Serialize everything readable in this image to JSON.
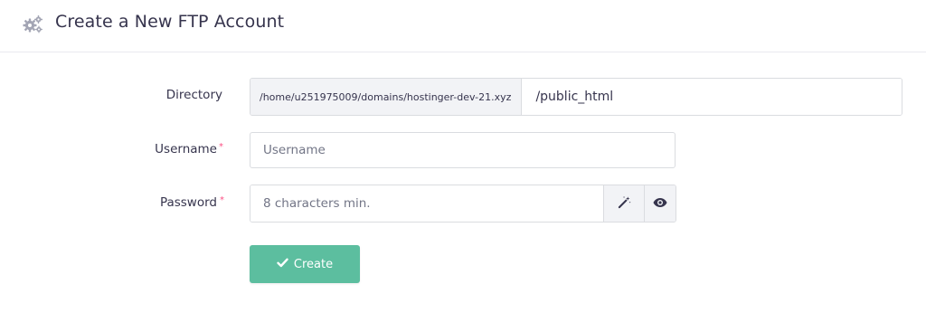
{
  "header": {
    "icon": "cogs-icon",
    "title": "Create a New FTP Account"
  },
  "form": {
    "directory": {
      "label": "Directory",
      "prefix": "/home/u251975009/domains/hostinger-dev-21.xyz",
      "value": "/public_html"
    },
    "username": {
      "label": "Username",
      "required_mark": "*",
      "placeholder": "Username"
    },
    "password": {
      "label": "Password",
      "required_mark": "*",
      "placeholder": "8 characters min.",
      "generate_icon": "magic-wand-icon",
      "toggle_icon": "eye-icon"
    },
    "submit": {
      "icon": "check-icon",
      "label": "Create"
    }
  },
  "colors": {
    "primary_text": "#36344d",
    "required": "#fc5185",
    "button": "#5cbe9f",
    "addon_bg": "#f2f3f6",
    "border": "#dadce0",
    "header_icon": "#a3a5b4"
  }
}
